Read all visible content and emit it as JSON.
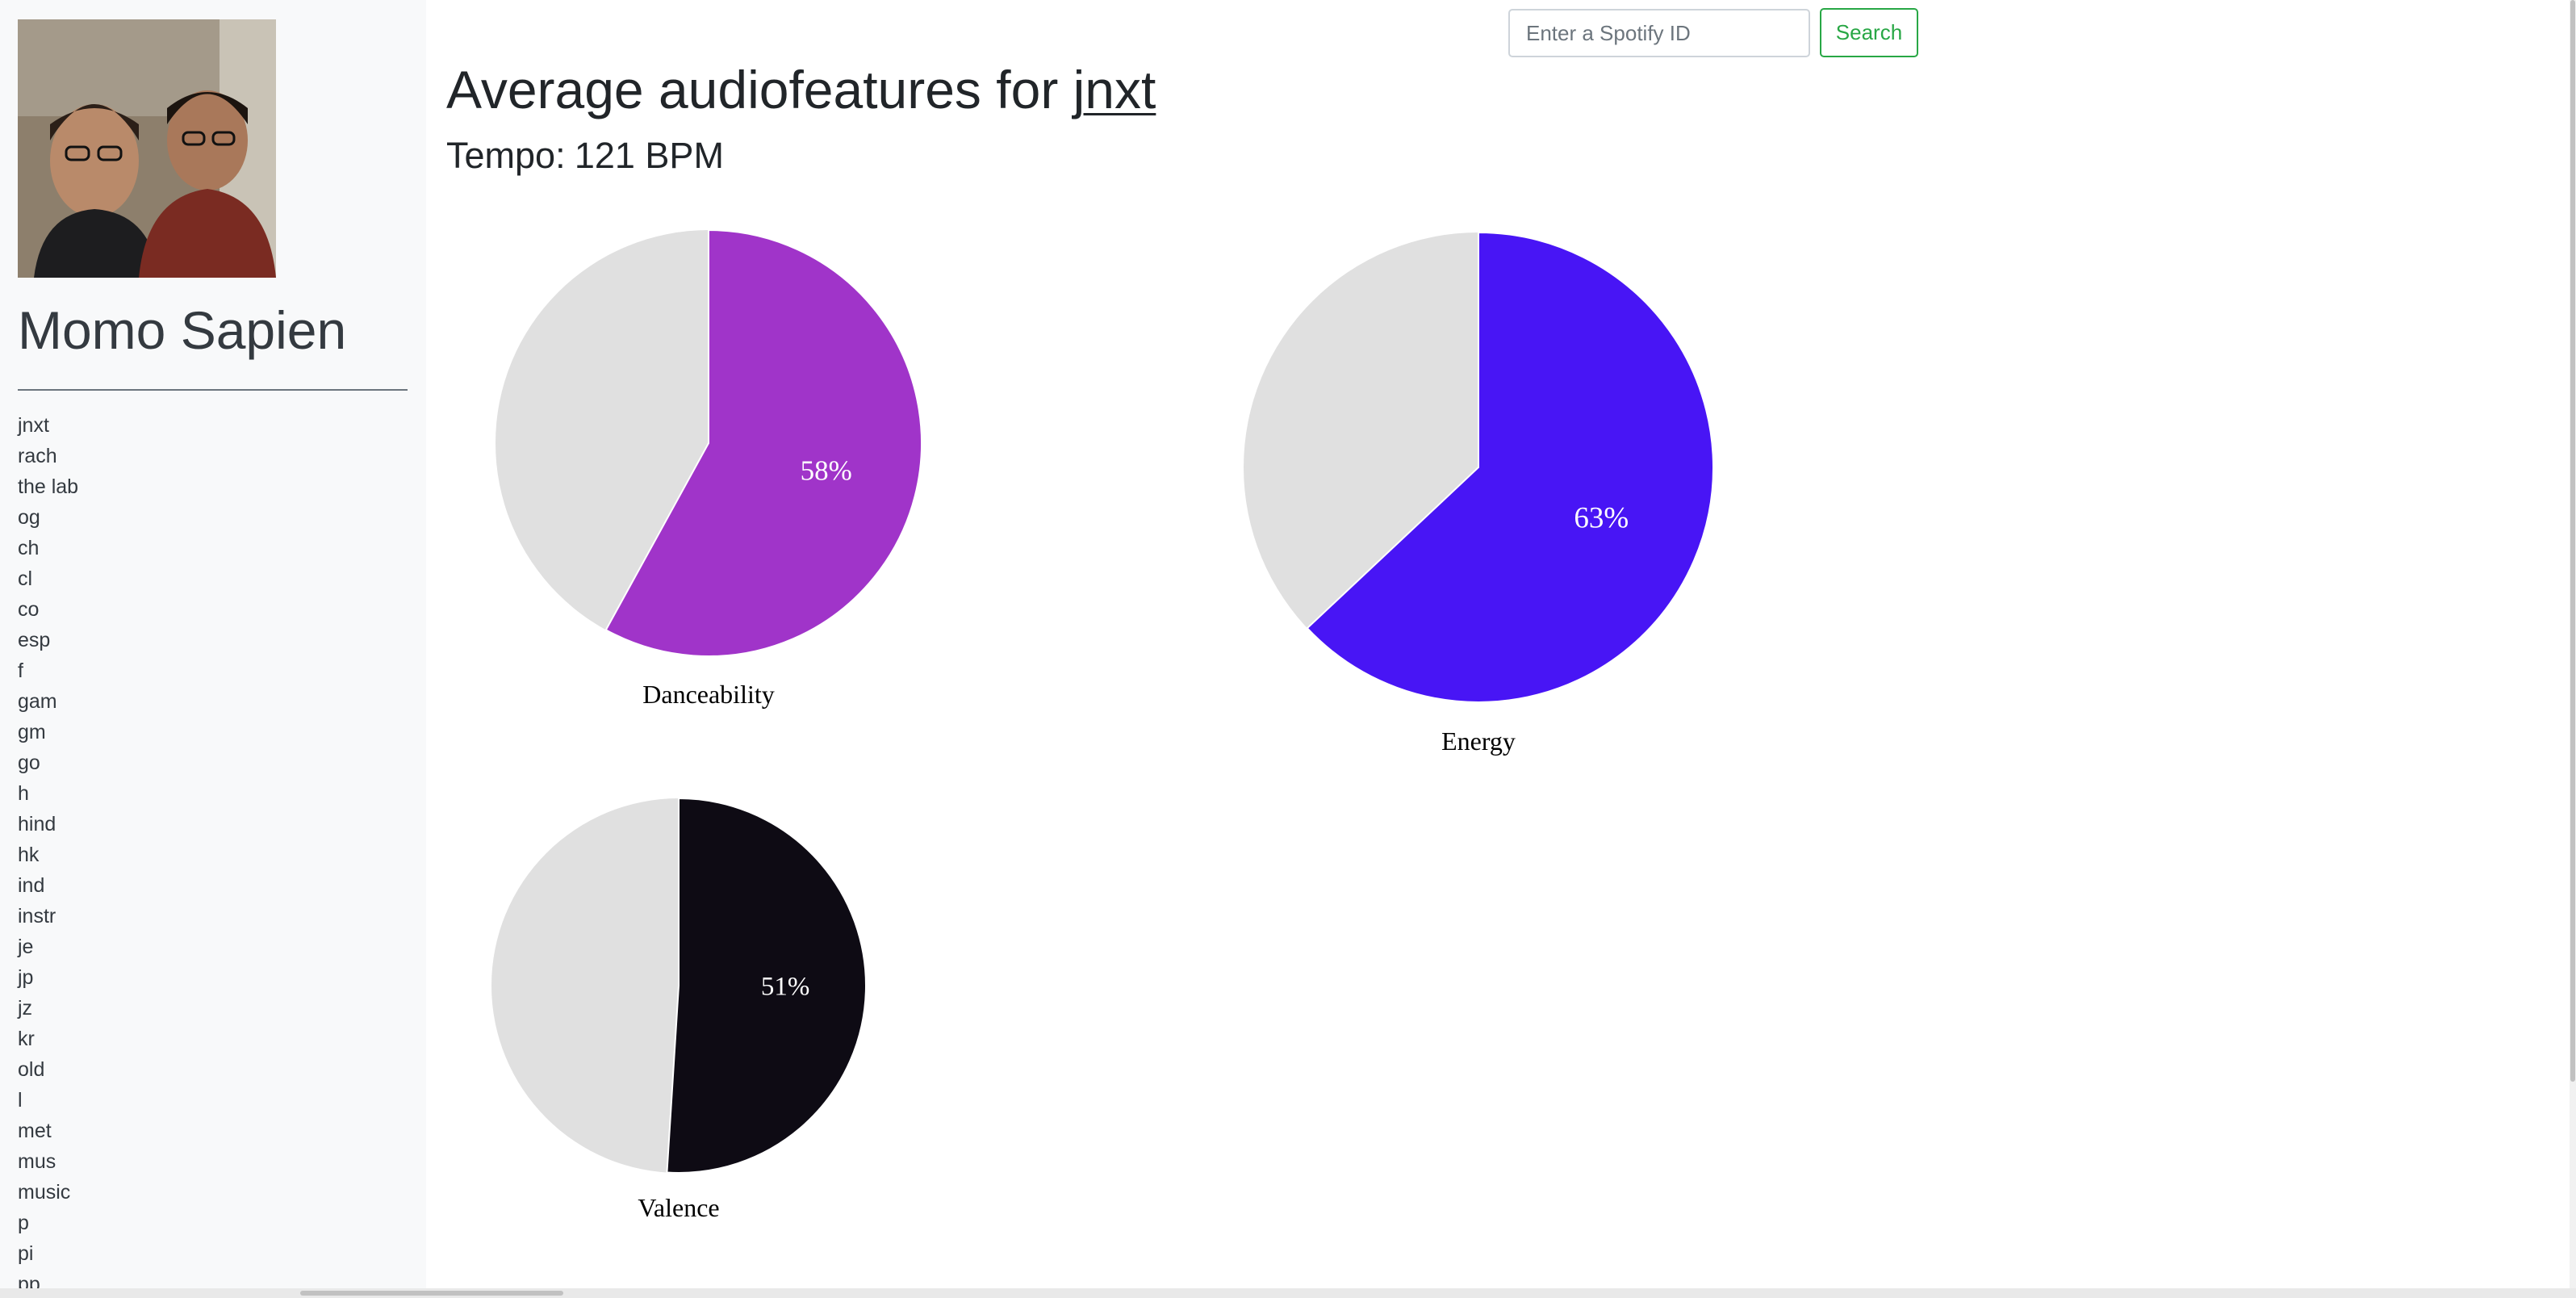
{
  "sidebar": {
    "profile_name": "Momo Sapien",
    "playlists": [
      "jnxt",
      "rach",
      "the lab",
      "og",
      "ch",
      "cl",
      "co",
      "esp",
      "f",
      "gam",
      "gm",
      "go",
      "h",
      "hind",
      "hk",
      "ind",
      "instr",
      "je",
      "jp",
      "jz",
      "kr",
      "old",
      "l",
      "met",
      "mus",
      "music",
      "p",
      "pi",
      "pp"
    ]
  },
  "search": {
    "placeholder": "Enter a Spotify ID",
    "button_label": "Search"
  },
  "header": {
    "title_prefix": "Average audiofeatures for",
    "playlist_link": "jnxt"
  },
  "tempo": {
    "label": "Tempo:",
    "value": "121 BPM"
  },
  "chart_data": [
    {
      "type": "pie",
      "title": "Danceability",
      "value": 58,
      "label": "58%",
      "color": "#a034c9",
      "remainder_color": "#e0e0e0"
    },
    {
      "type": "pie",
      "title": "Energy",
      "value": 63,
      "label": "63%",
      "color": "#4815f5",
      "remainder_color": "#e0e0e0"
    },
    {
      "type": "pie",
      "title": "Valence",
      "value": 51,
      "label": "51%",
      "color": "#0e0b14",
      "remainder_color": "#e0e0e0"
    }
  ]
}
